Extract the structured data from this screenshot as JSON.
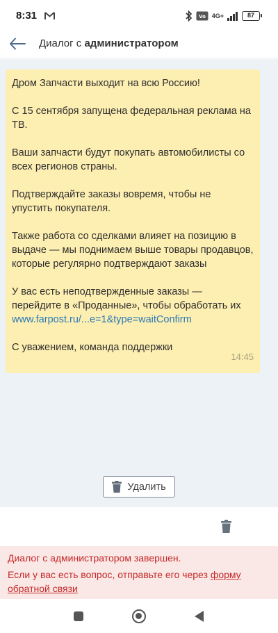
{
  "status": {
    "time": "8:31",
    "network": "4G+",
    "battery": "87"
  },
  "header": {
    "title_prefix": "Диалог с",
    "title_bold": "администратором"
  },
  "message": {
    "p1": "Дром Запчасти выходит на всю Россию!",
    "p2": "С 15 сентября запущена федеральная реклама на ТВ.",
    "p3": "Ваши запчасти будут покупать автомобилисты со всех регионов страны.",
    "p4": "Подтверждайте заказы вовремя, чтобы не упустить покупателя.",
    "p5": "Также работа со сделками влияет на позицию в выдаче — мы поднимаем выше товары продавцов, которые регулярно подтверждают заказы",
    "p6": "У вас есть неподтвержденные заказы — перейдите в «Проданные», чтобы обработать их",
    "link": "www.farpost.ru/...e=1&type=waitConfirm",
    "p7": "С уважением, команда поддержки",
    "time": "14:45"
  },
  "delete_button": {
    "label": "Удалить"
  },
  "notice": {
    "line1": "Диалог с администратором завершен.",
    "line2_text": "Если у вас есть вопрос, отправьте его через ",
    "line2_link": "форму обратной связи"
  },
  "colors": {
    "bubble": "#fdeeb1",
    "chat_bg": "#edf2f7",
    "link": "#2a7ab6",
    "notice_text": "#c62828",
    "notice_bg": "#f9e8e6"
  }
}
